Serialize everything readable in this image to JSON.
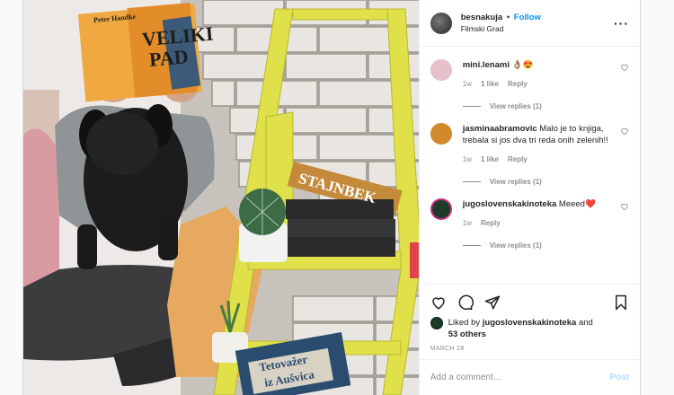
{
  "post": {
    "username": "besnakuja",
    "separator": "•",
    "follow_label": "Follow",
    "location": "Filmski Grad",
    "more_label": "···"
  },
  "photo": {
    "book1": {
      "author": "Peter Handke",
      "title1": "VELIKI",
      "title2": "PAD"
    },
    "book2": {
      "title": "STAJNBEK"
    },
    "book3": {
      "title1": "Tetovažer",
      "title2": "iz Aušvica"
    }
  },
  "comments": [
    {
      "user": "mini.lenami",
      "text": "👌🏽😍",
      "time": "1w",
      "likes": "1 like",
      "reply": "Reply",
      "view_replies": "View replies (1)",
      "avatar_color": "#e6c1c9"
    },
    {
      "user": "jasminaabramovic",
      "text": "Malo je to knjiga, trebala si jos dva tri reda onih zelenih!!",
      "time": "1w",
      "likes": "1 like",
      "reply": "Reply",
      "view_replies": "View replies (1)",
      "avatar_color": "#d0892c"
    },
    {
      "user": "jugoslovenskakinoteka",
      "text": "Meeed❤️",
      "time": "1w",
      "likes": "",
      "reply": "Reply",
      "view_replies": "View replies (1)",
      "avatar_color": "#1e3b2a"
    }
  ],
  "likes": {
    "prefix": "Liked by",
    "user": "jugoslovenskakinoteka",
    "middle": "and",
    "others": "53 others"
  },
  "date": "MARCH 28",
  "add_comment": {
    "placeholder": "Add a comment…",
    "post_label": "Post"
  },
  "colors": {
    "link_blue": "#0095f6",
    "muted": "#8e8e8e",
    "ladder_yellow": "#e0e24a"
  }
}
